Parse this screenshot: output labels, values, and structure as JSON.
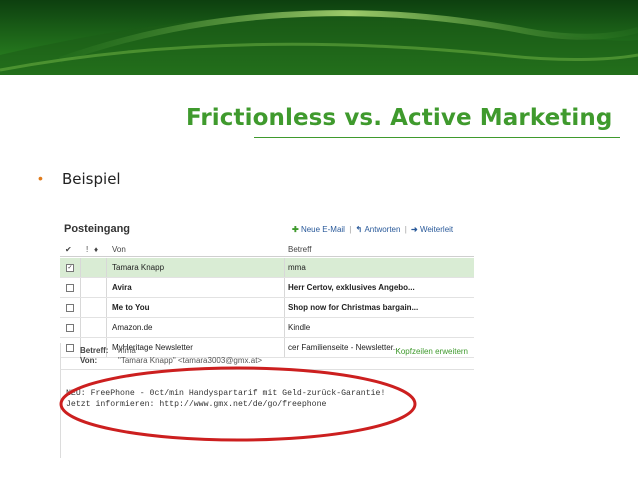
{
  "slide": {
    "title": "Frictionless vs. Active Marketing",
    "bullet": "Beispiel"
  },
  "mail": {
    "folder_title": "Posteingang",
    "toolbar": {
      "new_mail": "Neue E-Mail",
      "reply": "Antworten",
      "forward": "Weiterleit"
    },
    "columns": {
      "from": "Von",
      "subject": "Betreff"
    },
    "messages": [
      {
        "from": "Tamara Knapp",
        "subject": "mma",
        "checked": true,
        "selected": true,
        "bold": false
      },
      {
        "from": "Avira",
        "subject": "Herr Certov, exklusives Angebo...",
        "checked": false,
        "selected": false,
        "bold": true
      },
      {
        "from": "Me to You",
        "subject": "Shop now for Christmas bargain...",
        "checked": false,
        "selected": false,
        "bold": true
      },
      {
        "from": "Amazon.de",
        "subject": "Kindle",
        "checked": false,
        "selected": false,
        "bold": false
      },
      {
        "from": "MyHeritage Newsletter",
        "subject": "cer Familienseite - Newsletter...",
        "checked": false,
        "selected": false,
        "bold": false
      }
    ],
    "detail": {
      "subject_label": "Betreff:",
      "subject_value": "mma",
      "from_label": "Von:",
      "from_value": "\"Tamara Knapp\" <tamara3003@gmx.at>",
      "expand_headers": "Kopfzeilen erweitern"
    },
    "body_lines": [
      "NEU: FreePhone - 0ct/min Handyspartarif mit Geld-zurück-Garantie!",
      "Jetzt informieren: http://www.gmx.net/de/go/freephone"
    ]
  },
  "colors": {
    "accent_green": "#3f9a2d",
    "highlight_red": "#cc1f1f",
    "bullet_orange": "#e07b1c"
  }
}
